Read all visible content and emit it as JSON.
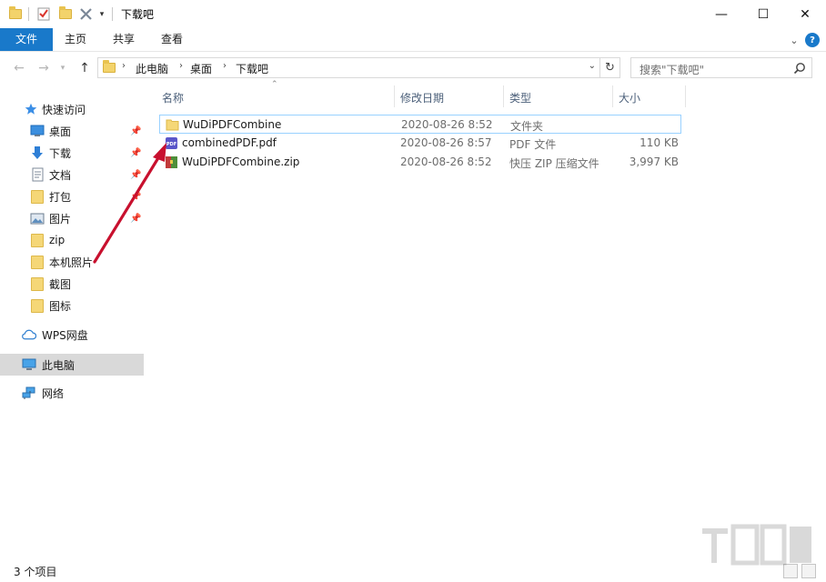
{
  "window": {
    "title": "下载吧",
    "controls": {
      "minimize": "—",
      "maximize": "☐",
      "close": "✕"
    }
  },
  "ribbon": {
    "tabs": [
      "文件",
      "主页",
      "共享",
      "查看"
    ],
    "expand_glyph": "⌄",
    "help_glyph": "?"
  },
  "nav": {
    "breadcrumb": [
      "此电脑",
      "桌面",
      "下载吧"
    ],
    "search_placeholder": "搜索\"下载吧\""
  },
  "sidebar": {
    "quick_access": "快速访问",
    "items": [
      {
        "label": "桌面",
        "icon": "desktop-icon",
        "pinned": true
      },
      {
        "label": "下载",
        "icon": "download-icon",
        "pinned": true
      },
      {
        "label": "文档",
        "icon": "document-icon",
        "pinned": true
      },
      {
        "label": "打包",
        "icon": "folder-icon",
        "pinned": true
      },
      {
        "label": "图片",
        "icon": "picture-icon",
        "pinned": true
      },
      {
        "label": "zip",
        "icon": "folder-icon",
        "pinned": false
      },
      {
        "label": "本机照片",
        "icon": "folder-icon",
        "pinned": false
      },
      {
        "label": "截图",
        "icon": "folder-icon",
        "pinned": false
      },
      {
        "label": "图标",
        "icon": "folder-icon",
        "pinned": false
      }
    ],
    "wps": "WPS网盘",
    "this_pc": "此电脑",
    "network": "网络"
  },
  "columns": [
    "名称",
    "修改日期",
    "类型",
    "大小"
  ],
  "files": [
    {
      "name": "WuDiPDFCombine",
      "date": "2020-08-26 8:52",
      "type": "文件夹",
      "size": "",
      "icon": "folder-icon"
    },
    {
      "name": "combinedPDF.pdf",
      "date": "2020-08-26 8:57",
      "type": "PDF 文件",
      "size": "110 KB",
      "icon": "pdf-icon"
    },
    {
      "name": "WuDiPDFCombine.zip",
      "date": "2020-08-26 8:52",
      "type": "快压 ZIP 压缩文件",
      "size": "3,997 KB",
      "icon": "zip-icon"
    }
  ],
  "status": {
    "count": "3 个项目"
  },
  "colors": {
    "accent": "#1979ca",
    "selection_border": "#99d1ff",
    "arrow": "#c8102e"
  }
}
